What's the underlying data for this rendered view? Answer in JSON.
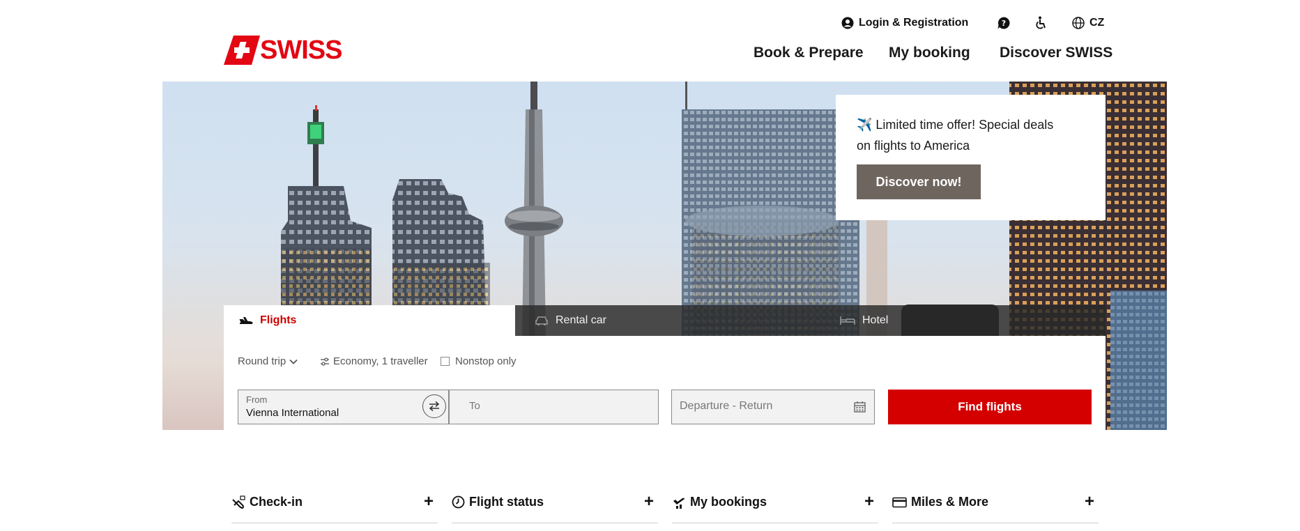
{
  "brand": {
    "name": "SWISS",
    "color": "#e30613"
  },
  "utility_nav": {
    "login_label": "Login & Registration",
    "language_label": "CZ",
    "icons": [
      "user-circle-icon",
      "help-icon",
      "accessibility-icon",
      "globe-icon"
    ]
  },
  "main_nav": {
    "items": [
      {
        "label": "Book & Prepare"
      },
      {
        "label": "My booking"
      },
      {
        "label": "Discover SWISS"
      }
    ]
  },
  "promo": {
    "text": "✈️ Limited time offer! Special deals on flights to America",
    "button_label": "Discover now!",
    "button_color": "#6e655e"
  },
  "booking": {
    "tabs": [
      {
        "label": "Flights",
        "active": true,
        "icon": "plane-icon"
      },
      {
        "label": "Rental car",
        "active": false,
        "icon": "car-icon"
      },
      {
        "label": "Hotel",
        "active": false,
        "icon": "bed-icon"
      }
    ],
    "trip_type": "Round trip",
    "cabin_travellers": "Economy, 1 traveller",
    "nonstop_label": "Nonstop only",
    "from_label": "From",
    "from_value": "Vienna International",
    "to_placeholder": "To",
    "dates_placeholder": "Departure - Return",
    "find_button_label": "Find flights",
    "accent_color": "#d40000"
  },
  "quick_links": [
    {
      "label": "Check-in",
      "icon": "checkin-icon"
    },
    {
      "label": "Flight status",
      "icon": "clock-icon"
    },
    {
      "label": "My bookings",
      "icon": "plane-takeoff-icon"
    },
    {
      "label": "Miles & More",
      "icon": "card-icon"
    }
  ]
}
